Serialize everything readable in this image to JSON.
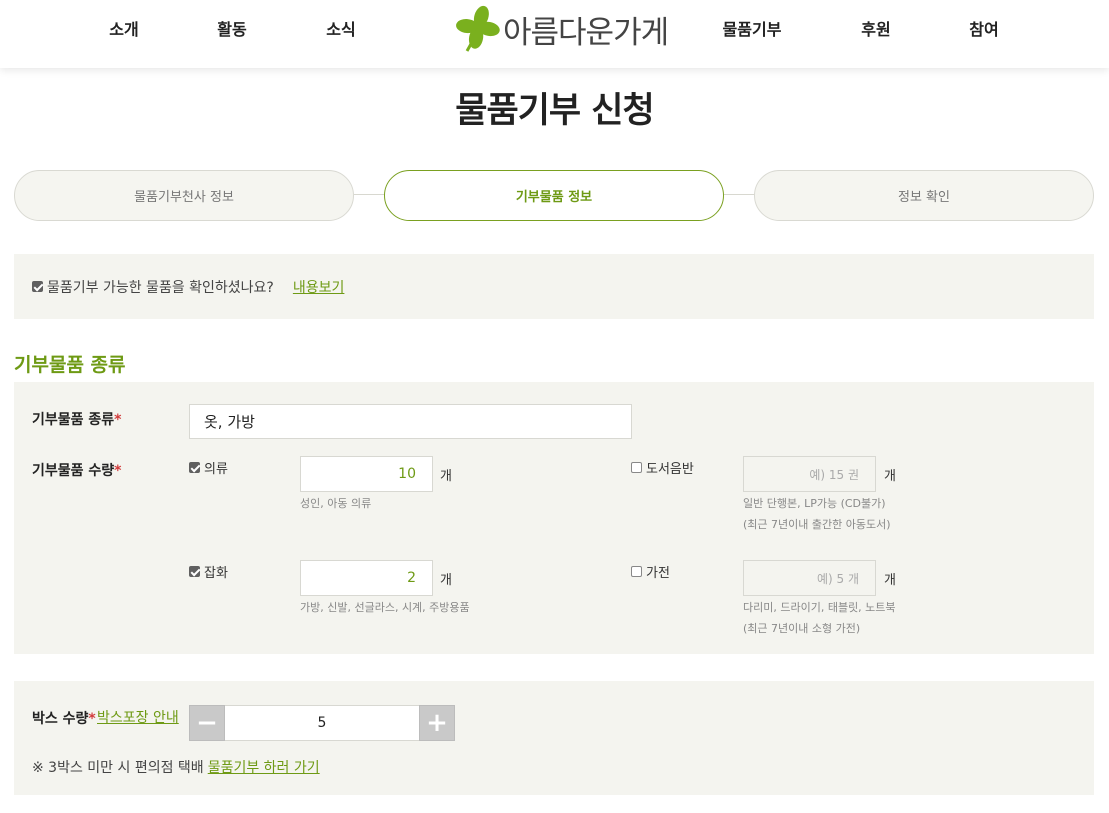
{
  "header": {
    "nav_left": [
      "소개",
      "활동",
      "소식"
    ],
    "logo_text": "아름다운가게",
    "nav_right": [
      "물품기부",
      "후원",
      "참여"
    ]
  },
  "page_title": "물품기부 신청",
  "steps": [
    {
      "label": "물품기부천사 정보",
      "active": false
    },
    {
      "label": "기부물품 정보",
      "active": true
    },
    {
      "label": "정보 확인",
      "active": false
    }
  ],
  "notice": {
    "checked": true,
    "text": "물품기부 가능한 물품을 확인하셨나요?",
    "link": "내용보기"
  },
  "section_title": "기부물품 종류",
  "form": {
    "type_label": "기부물품 종류",
    "type_value": "옷, 가방",
    "qty_label": "기부물품 수량",
    "required_mark": "*",
    "items": [
      {
        "label": "의류",
        "checked": true,
        "value": "10",
        "placeholder": "",
        "unit": "개",
        "help": [
          "성인, 아동 의류"
        ]
      },
      {
        "label": "도서음반",
        "checked": false,
        "value": "",
        "placeholder": "예) 15 권",
        "unit": "개",
        "help": [
          "일반 단행본, LP가능 (CD불가)",
          "(최근 7년이내 출간한 아동도서)"
        ]
      },
      {
        "label": "잡화",
        "checked": true,
        "value": "2",
        "placeholder": "",
        "unit": "개",
        "help": [
          "가방, 신발, 선글라스, 시계, 주방용품"
        ]
      },
      {
        "label": "가전",
        "checked": false,
        "value": "",
        "placeholder": "예) 5 개",
        "unit": "개",
        "help": [
          "다리미, 드라이기, 태블릿, 노트북",
          "(최근 7년이내 소형 가전)"
        ]
      }
    ]
  },
  "box": {
    "label": "박스 수량",
    "guide_link": "박스포장 안내",
    "minus": "−",
    "plus": "+",
    "value": "5",
    "note": "※ 3박스 미만 시 편의점 택배",
    "note_link": "물품기부 하러 가기"
  },
  "colors": {
    "accent": "#6e9a14",
    "logo_green": "#7ab01e",
    "panel_bg": "#f4f4ef",
    "required": "#d23b3b"
  }
}
